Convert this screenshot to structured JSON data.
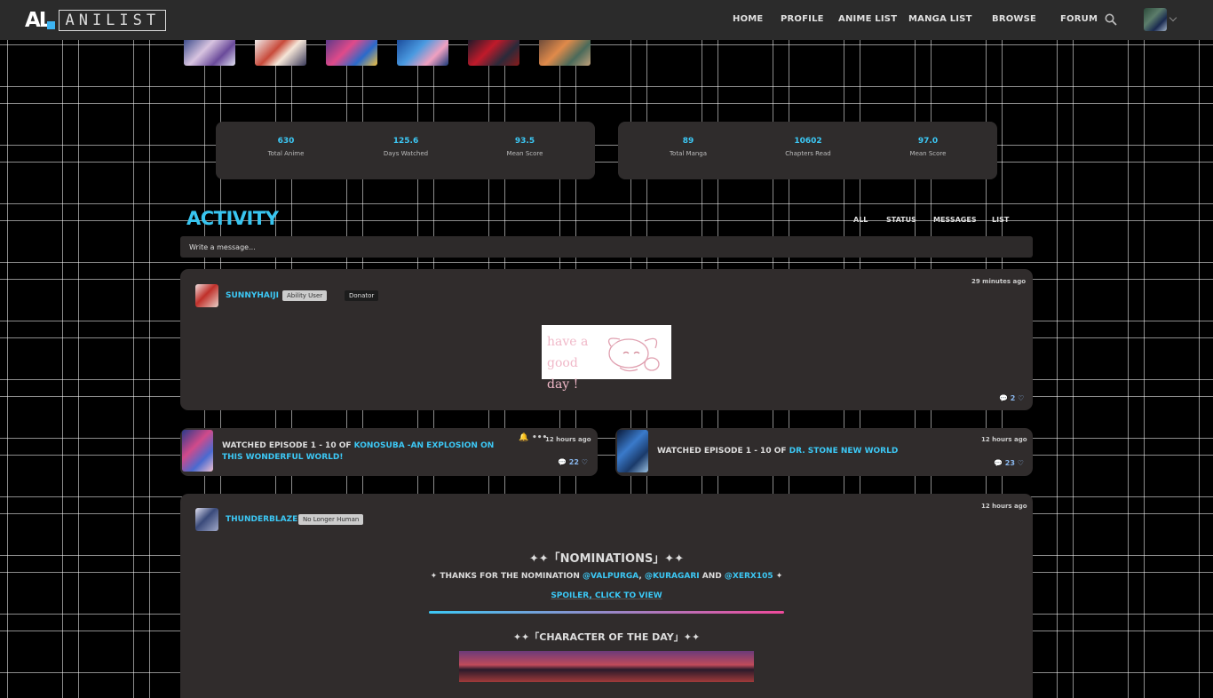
{
  "brand": {
    "logo_mark": "AL",
    "logo_text": "ANILIST"
  },
  "nav": {
    "items": [
      "HOME",
      "PROFILE",
      "ANIME LIST",
      "MANGA LIST",
      "BROWSE",
      "FORUM"
    ]
  },
  "stats": {
    "anime": [
      {
        "value": "630",
        "label": "Total Anime"
      },
      {
        "value": "125.6",
        "label": "Days Watched"
      },
      {
        "value": "93.5",
        "label": "Mean Score"
      }
    ],
    "manga": [
      {
        "value": "89",
        "label": "Total Manga"
      },
      {
        "value": "10602",
        "label": "Chapters Read"
      },
      {
        "value": "97.0",
        "label": "Mean Score"
      }
    ]
  },
  "activity": {
    "title": "ACTIVITY",
    "filters": [
      "ALL",
      "STATUS",
      "MESSAGES",
      "LIST"
    ],
    "input_placeholder": "Write a message..."
  },
  "post1": {
    "user": "SUNNYHAIJI",
    "badge1": "Ability User",
    "badge2": "Donator",
    "time": "29 minutes ago",
    "image_text": "have a good day !",
    "likes": "2"
  },
  "list1": {
    "prefix": "WATCHED EPISODE 1 - 10 OF ",
    "title": "KONOSUBA -AN EXPLOSION ON THIS WONDERFUL WORLD!",
    "time": "12 hours ago",
    "likes": "22"
  },
  "list2": {
    "prefix": "WATCHED EPISODE 1 - 10 OF ",
    "title": "DR. STONE NEW WORLD",
    "time": "12 hours ago",
    "likes": "23"
  },
  "post2": {
    "user": "THUNDERBLAZE",
    "badge": "No Longer Human",
    "time": "12 hours ago",
    "heading": "✦✦「NOMINATIONS」✦✦",
    "thanks_prefix": "✦ THANKS FOR THE NOMINATION ",
    "m1": "@VALPURGA",
    "sep1": ", ",
    "m2": "@KURAGARI",
    "sep2": " AND ",
    "m3": "@XERX105",
    "thanks_suffix": " ✦",
    "spoiler": "SPOILER, CLICK TO VIEW",
    "heading2": "✦✦「CHARACTER OF THE DAY」✦✦"
  },
  "colors": {
    "accent": "#3cc8f5",
    "card": "#302c2c",
    "nav": "#2b2b2b"
  }
}
